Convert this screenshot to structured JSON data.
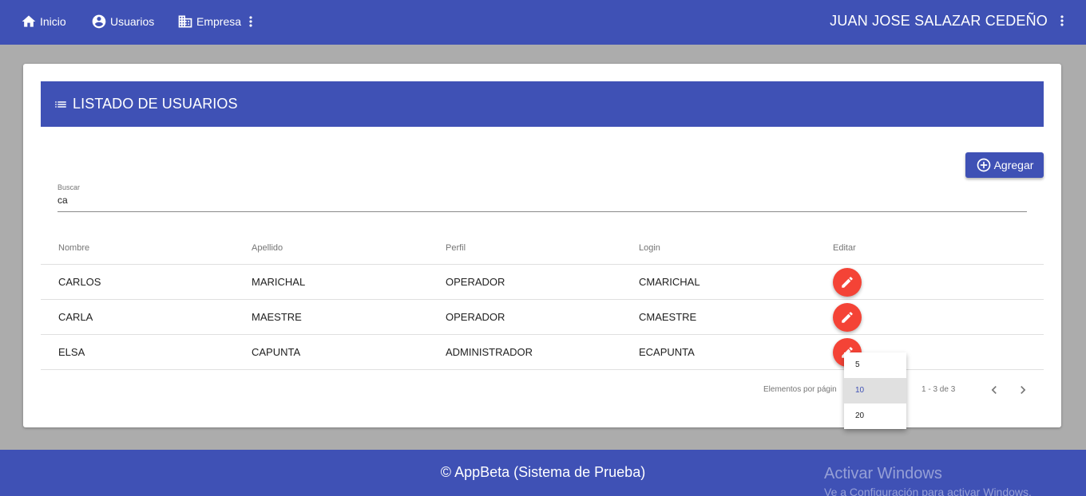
{
  "nav": {
    "items": [
      {
        "label": "Inicio",
        "icon": "home-icon"
      },
      {
        "label": "Usuarios",
        "icon": "account-circle-icon"
      },
      {
        "label": "Empresa",
        "icon": "business-icon"
      }
    ],
    "user_name": "JUAN JOSE SALAZAR CEDEÑO"
  },
  "card": {
    "title": "LISTADO DE USUARIOS",
    "add_label": "Agregar",
    "search": {
      "label": "Buscar",
      "value": "ca"
    }
  },
  "table": {
    "headers": [
      "Nombre",
      "Apellido",
      "Perfil",
      "Login",
      "Editar"
    ],
    "rows": [
      {
        "nombre": "CARLOS",
        "apellido": "MARICHAL",
        "perfil": "OPERADOR",
        "login": "CMARICHAL"
      },
      {
        "nombre": "CARLA",
        "apellido": "MAESTRE",
        "perfil": "OPERADOR",
        "login": "CMAESTRE"
      },
      {
        "nombre": "ELSA",
        "apellido": "CAPUNTA",
        "perfil": "ADMINISTRADOR",
        "login": "ECAPUNTA"
      }
    ]
  },
  "paginator": {
    "label": "Elementos por págin",
    "range": "1 - 3 de 3",
    "options": [
      "5",
      "10",
      "20"
    ],
    "selected": "10"
  },
  "footer": {
    "text": "© AppBeta (Sistema de Prueba)"
  },
  "watermark": {
    "line1": "Activar Windows",
    "line2": "Ve a Configuración para activar Windows."
  },
  "colors": {
    "primary": "#3f51b5",
    "accent": "#f44336",
    "background": "#acacac"
  }
}
